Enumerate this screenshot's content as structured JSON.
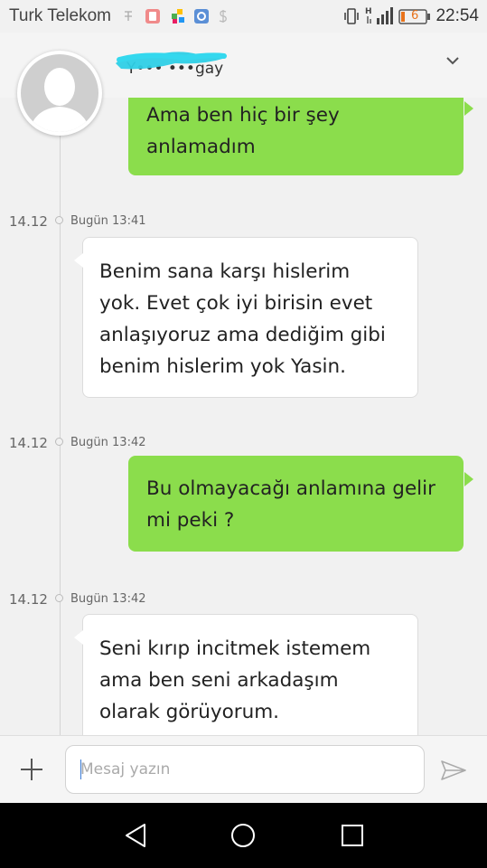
{
  "status": {
    "carrier": "Turk Telekom",
    "battery": "6",
    "time": "22:54"
  },
  "contact": {
    "name": "Y••• •••gay"
  },
  "messages": [
    {
      "dir": "out",
      "lines": [
        "Ama ben hiç bir şey",
        "anlamadım"
      ]
    },
    {
      "dir": "in",
      "date": "14.12",
      "stamp": "Bugün 13:41",
      "lines": [
        "Benim sana karşı hislerim",
        "yok. Evet çok iyi birisin evet",
        "anlaşıyoruz ama dediğim gibi",
        "benim hislerim yok Yasin."
      ]
    },
    {
      "dir": "out",
      "date": "14.12",
      "stamp": "Bugün 13:42",
      "lines": [
        "Bu olmayacağı anlamına gelir",
        "mi peki ?"
      ]
    },
    {
      "dir": "in",
      "date": "14.12",
      "stamp": "Bugün 13:42",
      "lines": [
        "Seni kırıp incitmek istemem",
        "ama ben seni arkadaşım",
        "olarak görüyorum."
      ]
    }
  ],
  "composer": {
    "placeholder": "Mesaj yazın"
  },
  "icons": {
    "add": "plus-icon",
    "send": "send-icon",
    "expand": "chevron-down-icon",
    "nav_back": "triangle-back-icon",
    "nav_home": "circle-home-icon",
    "nav_recents": "square-recents-icon"
  },
  "colors": {
    "outgoing_bubble": "#8bdd4c",
    "incoming_bubble": "#ffffff",
    "background": "#f1f1f1",
    "battery": "#e8731c"
  }
}
